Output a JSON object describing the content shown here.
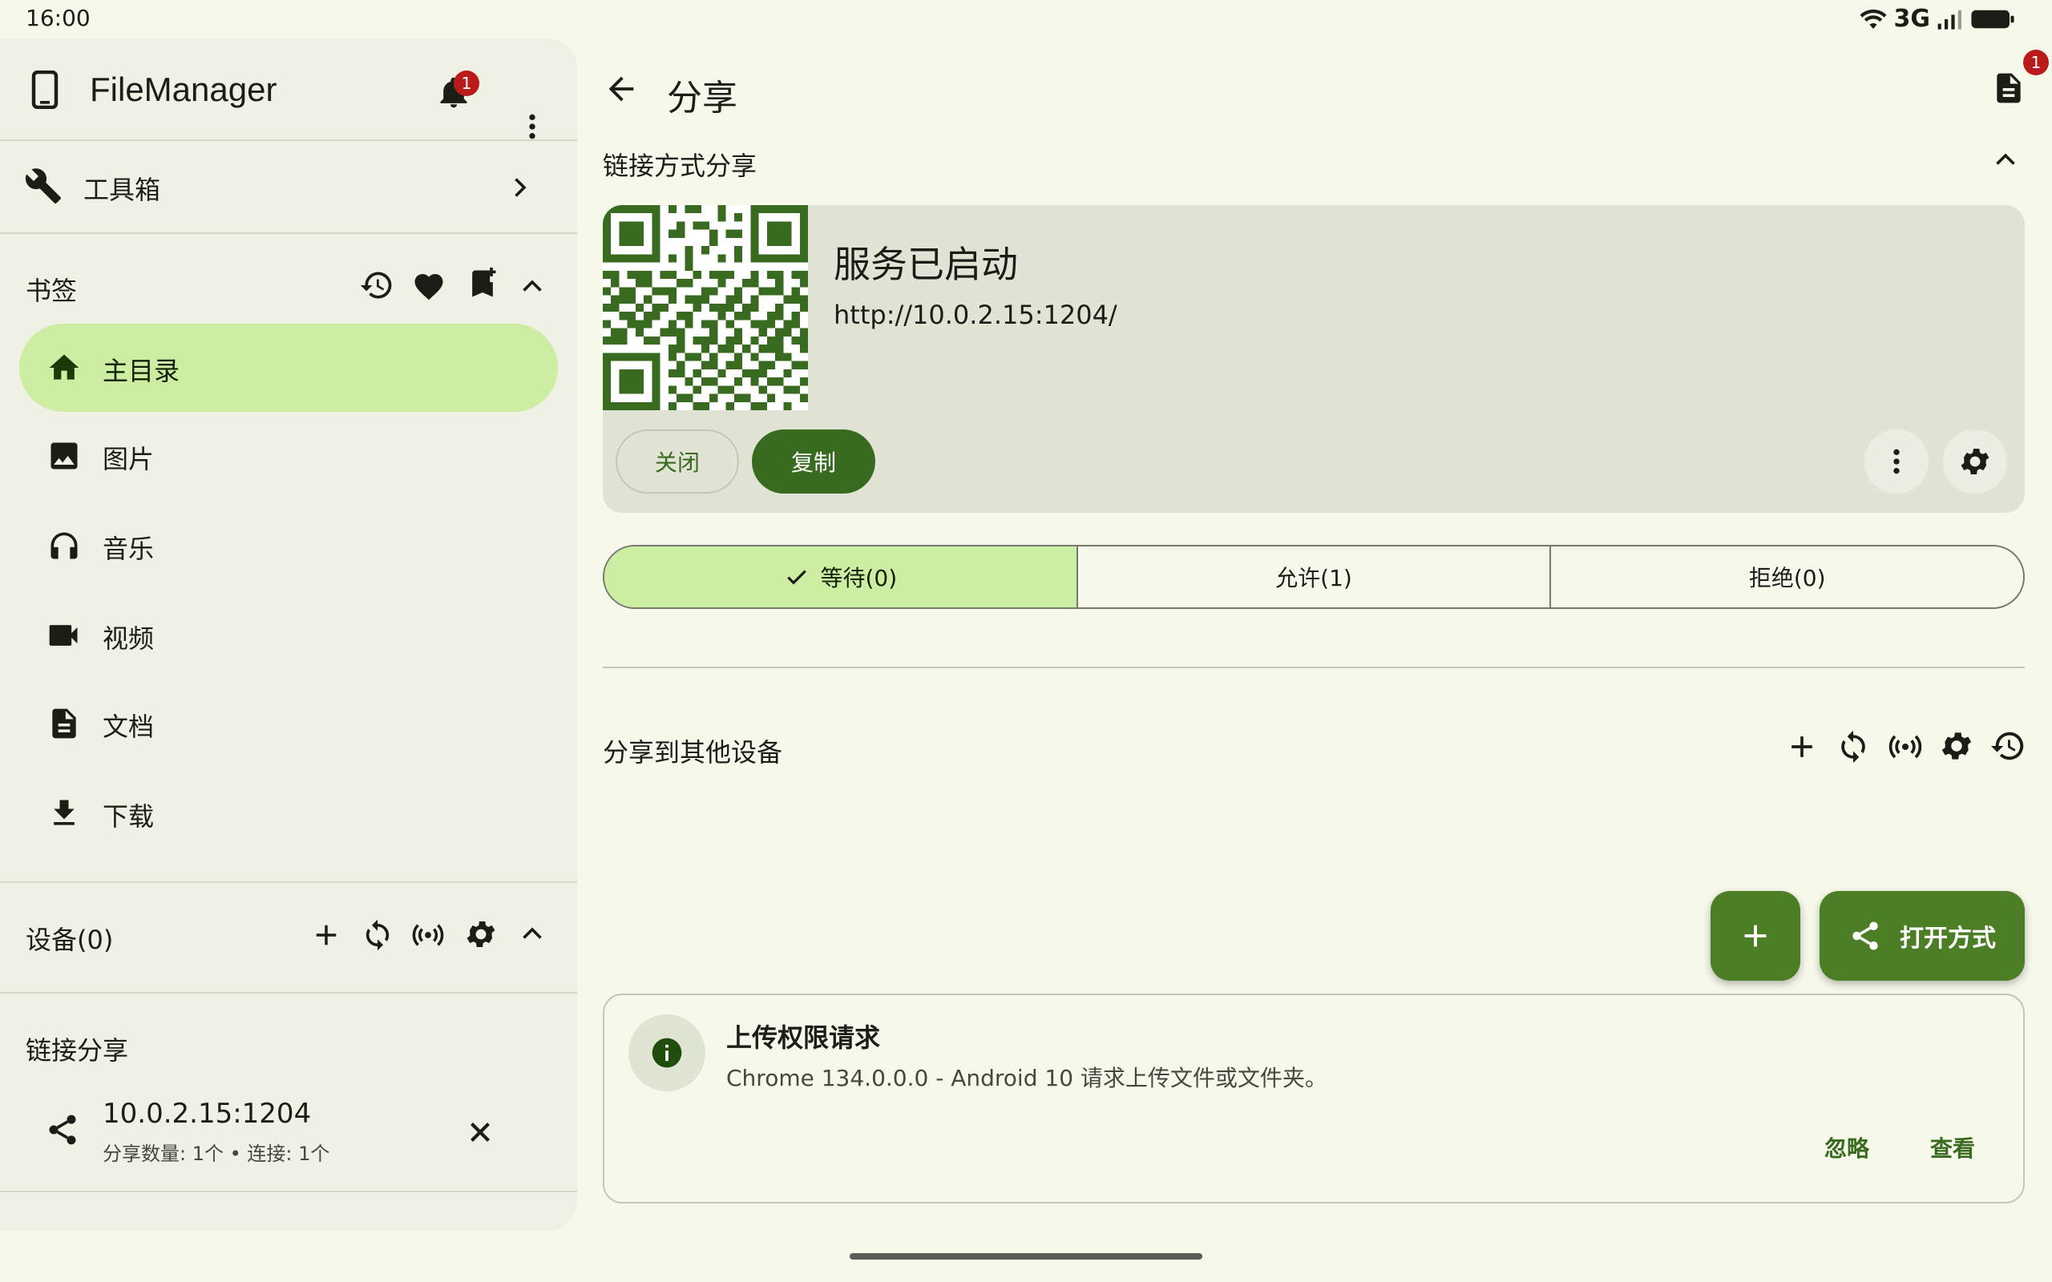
{
  "status_bar": {
    "time": "16:00",
    "network": "3G"
  },
  "drawer": {
    "app_title": "FileManager",
    "notification_count": "1",
    "toolbox_label": "工具箱",
    "bookmarks_label": "书签",
    "bookmarks": [
      {
        "label": "主目录",
        "icon": "home-icon",
        "active": true
      },
      {
        "label": "图片",
        "icon": "image-icon"
      },
      {
        "label": "音乐",
        "icon": "headphones-icon"
      },
      {
        "label": "视频",
        "icon": "video-icon"
      },
      {
        "label": "文档",
        "icon": "document-icon"
      },
      {
        "label": "下载",
        "icon": "download-icon"
      }
    ],
    "devices_label": "设备(0)",
    "link_share_label": "链接分享",
    "link_share_item": {
      "address": "10.0.2.15:1204",
      "details": "分享数量: 1个 • 连接: 1个"
    }
  },
  "main": {
    "title": "分享",
    "log_badge": "1",
    "link_section_title": "链接方式分享",
    "service": {
      "status": "服务已启动",
      "url": "http://10.0.2.15:1204/",
      "close_label": "关闭",
      "copy_label": "复制"
    },
    "segments": [
      {
        "label": "等待(0)",
        "active": true
      },
      {
        "label": "允许(1)"
      },
      {
        "label": "拒绝(0)"
      }
    ],
    "other_devices_title": "分享到其他设备",
    "open_with_label": "打开方式",
    "notice": {
      "title": "上传权限请求",
      "message": "Chrome 134.0.0.0 - Android 10 请求上传文件或文件夹。",
      "ignore_label": "忽略",
      "view_label": "查看"
    }
  },
  "colors": {
    "accent": "#386a1f",
    "active_bg": "#cdeda3",
    "badge": "#ba1a1a"
  }
}
